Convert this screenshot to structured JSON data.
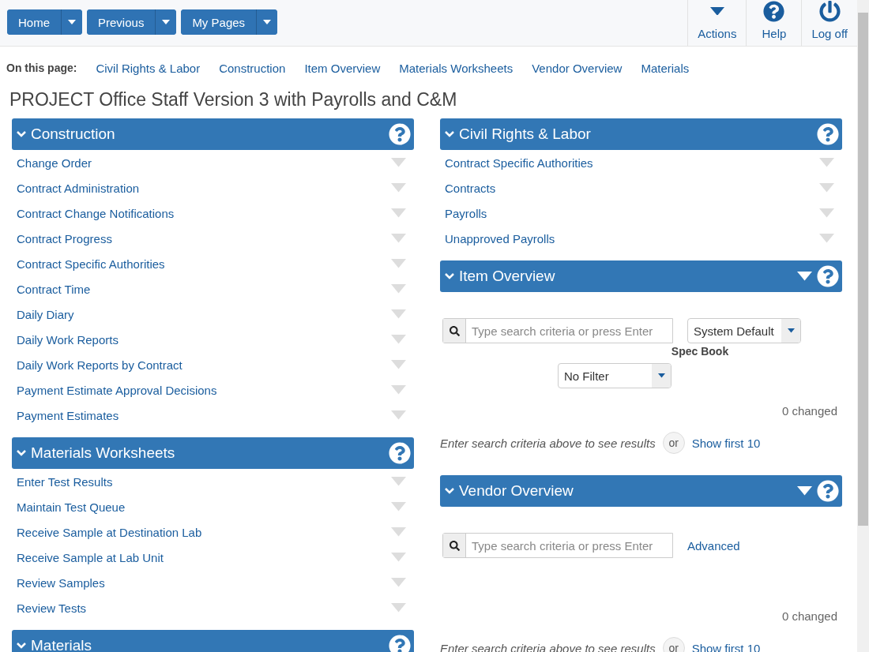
{
  "nav": {
    "buttons": [
      {
        "label": "Home"
      },
      {
        "label": "Previous"
      },
      {
        "label": "My Pages"
      }
    ],
    "actions": [
      {
        "kind": "actions",
        "label": "Actions"
      },
      {
        "kind": "help",
        "label": "Help"
      },
      {
        "kind": "logoff",
        "label": "Log off"
      }
    ]
  },
  "on_this_page": {
    "label": "On this page:",
    "links": [
      "Civil Rights & Labor",
      "Construction",
      "Item Overview",
      "Materials Worksheets",
      "Vendor Overview",
      "Materials"
    ]
  },
  "title": "PROJECT Office Staff Version 3 with Payrolls and C&M",
  "columns": [
    [
      {
        "kind": "links",
        "title": "Construction",
        "header_menu": false,
        "items": [
          "Change Order",
          "Contract Administration",
          "Contract Change Notifications",
          "Contract Progress",
          "Contract Specific Authorities",
          "Contract Time",
          "Daily Diary",
          "Daily Work Reports",
          "Daily Work Reports by Contract",
          "Payment Estimate Approval Decisions",
          "Payment Estimates"
        ]
      },
      {
        "kind": "links",
        "title": "Materials Worksheets",
        "header_menu": false,
        "items": [
          "Enter Test Results",
          "Maintain Test Queue",
          "Receive Sample at Destination Lab",
          "Receive Sample at Lab Unit",
          "Review Samples",
          "Review Tests"
        ]
      },
      {
        "kind": "links",
        "title": "Materials",
        "header_menu": false
      }
    ],
    [
      {
        "kind": "links",
        "title": "Civil Rights & Labor",
        "header_menu": false,
        "items": [
          "Contract Specific Authorities",
          "Contracts",
          "Payrolls",
          "Unapproved Payrolls"
        ]
      },
      {
        "kind": "search",
        "title": "Item Overview",
        "header_menu": true,
        "search_placeholder": "Type search criteria or press Enter",
        "view_select": "System Default",
        "filter": {
          "label": "Spec Book",
          "value": "No Filter"
        },
        "changed": "0 changed",
        "hint": "Enter search criteria above to see results",
        "or": "or",
        "show_link": "Show first 10"
      },
      {
        "kind": "search",
        "title": "Vendor Overview",
        "header_menu": true,
        "search_placeholder": "Type search criteria or press Enter",
        "advanced_link": "Advanced",
        "changed": "0 changed",
        "hint": "Enter search criteria above to see results",
        "or": "or",
        "show_link": "Show first 10"
      }
    ]
  ]
}
